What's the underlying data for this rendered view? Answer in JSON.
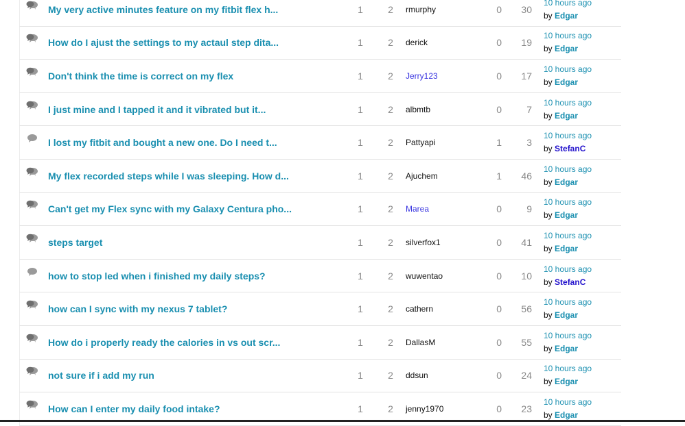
{
  "topics": {
    "by_prefix": "by",
    "rows": [
      {
        "title": "My very active minutes feature on my fitbit flex h...",
        "views": "1",
        "count": "2",
        "author": "rmurphy",
        "author_link": false,
        "kudos": "0",
        "replies": "30",
        "last_time": "10 hours ago",
        "last_user": "Edgar",
        "last_user_admin": false,
        "icon": "speech-bubbles-icon"
      },
      {
        "title": "How do I ajust the settings to my actaul step dita...",
        "views": "1",
        "count": "2",
        "author": "derick",
        "author_link": false,
        "kudos": "0",
        "replies": "19",
        "last_time": "10 hours ago",
        "last_user": "Edgar",
        "last_user_admin": false,
        "icon": "speech-bubbles-icon"
      },
      {
        "title": "Don't think the time is correct on my flex",
        "views": "1",
        "count": "2",
        "author": "Jerry123",
        "author_link": true,
        "kudos": "0",
        "replies": "17",
        "last_time": "10 hours ago",
        "last_user": "Edgar",
        "last_user_admin": false,
        "icon": "speech-bubbles-icon"
      },
      {
        "title": "I just mine and I tapped it and it vibrated but it...",
        "views": "1",
        "count": "2",
        "author": "albmtb",
        "author_link": false,
        "kudos": "0",
        "replies": "7",
        "last_time": "10 hours ago",
        "last_user": "Edgar",
        "last_user_admin": false,
        "icon": "speech-bubbles-icon"
      },
      {
        "title": "I lost my fitbit and bought a new one. Do I need t...",
        "views": "1",
        "count": "2",
        "author": "Pattyapi",
        "author_link": false,
        "kudos": "1",
        "replies": "3",
        "last_time": "10 hours ago",
        "last_user": "StefanC",
        "last_user_admin": true,
        "icon": "speech-bubble-icon"
      },
      {
        "title": "My flex recorded steps while I was sleeping. How d...",
        "views": "1",
        "count": "2",
        "author": "Ajuchem",
        "author_link": false,
        "kudos": "1",
        "replies": "46",
        "last_time": "10 hours ago",
        "last_user": "Edgar",
        "last_user_admin": false,
        "icon": "speech-bubbles-icon"
      },
      {
        "title": "Can't get my Flex sync with my Galaxy Centura pho...",
        "views": "1",
        "count": "2",
        "author": "Marea",
        "author_link": true,
        "kudos": "0",
        "replies": "9",
        "last_time": "10 hours ago",
        "last_user": "Edgar",
        "last_user_admin": false,
        "icon": "speech-bubbles-icon"
      },
      {
        "title": "steps target",
        "views": "1",
        "count": "2",
        "author": "silverfox1",
        "author_link": false,
        "kudos": "0",
        "replies": "41",
        "last_time": "10 hours ago",
        "last_user": "Edgar",
        "last_user_admin": false,
        "icon": "speech-bubbles-icon"
      },
      {
        "title": "how to stop led when i finished my daily steps?",
        "views": "1",
        "count": "2",
        "author": "wuwentao",
        "author_link": false,
        "kudos": "0",
        "replies": "10",
        "last_time": "10 hours ago",
        "last_user": "StefanC",
        "last_user_admin": true,
        "icon": "speech-bubble-icon"
      },
      {
        "title": "how can I sync with my nexus 7 tablet?",
        "views": "1",
        "count": "2",
        "author": "cathern",
        "author_link": false,
        "kudos": "0",
        "replies": "56",
        "last_time": "10 hours ago",
        "last_user": "Edgar",
        "last_user_admin": false,
        "icon": "speech-bubbles-icon"
      },
      {
        "title": "How do i properly ready the calories in vs out scr...",
        "views": "1",
        "count": "2",
        "author": "DallasM",
        "author_link": false,
        "kudos": "0",
        "replies": "55",
        "last_time": "10 hours ago",
        "last_user": "Edgar",
        "last_user_admin": false,
        "icon": "speech-bubbles-icon"
      },
      {
        "title": "not sure if i add my run",
        "views": "1",
        "count": "2",
        "author": "ddsun",
        "author_link": false,
        "kudos": "0",
        "replies": "24",
        "last_time": "10 hours ago",
        "last_user": "Edgar",
        "last_user_admin": false,
        "icon": "speech-bubbles-icon"
      },
      {
        "title": "How can I enter my daily food intake?",
        "views": "1",
        "count": "2",
        "author": "jenny1970",
        "author_link": false,
        "kudos": "0",
        "replies": "23",
        "last_time": "10 hours ago",
        "last_user": "Edgar",
        "last_user_admin": false,
        "icon": "speech-bubbles-icon"
      }
    ]
  }
}
